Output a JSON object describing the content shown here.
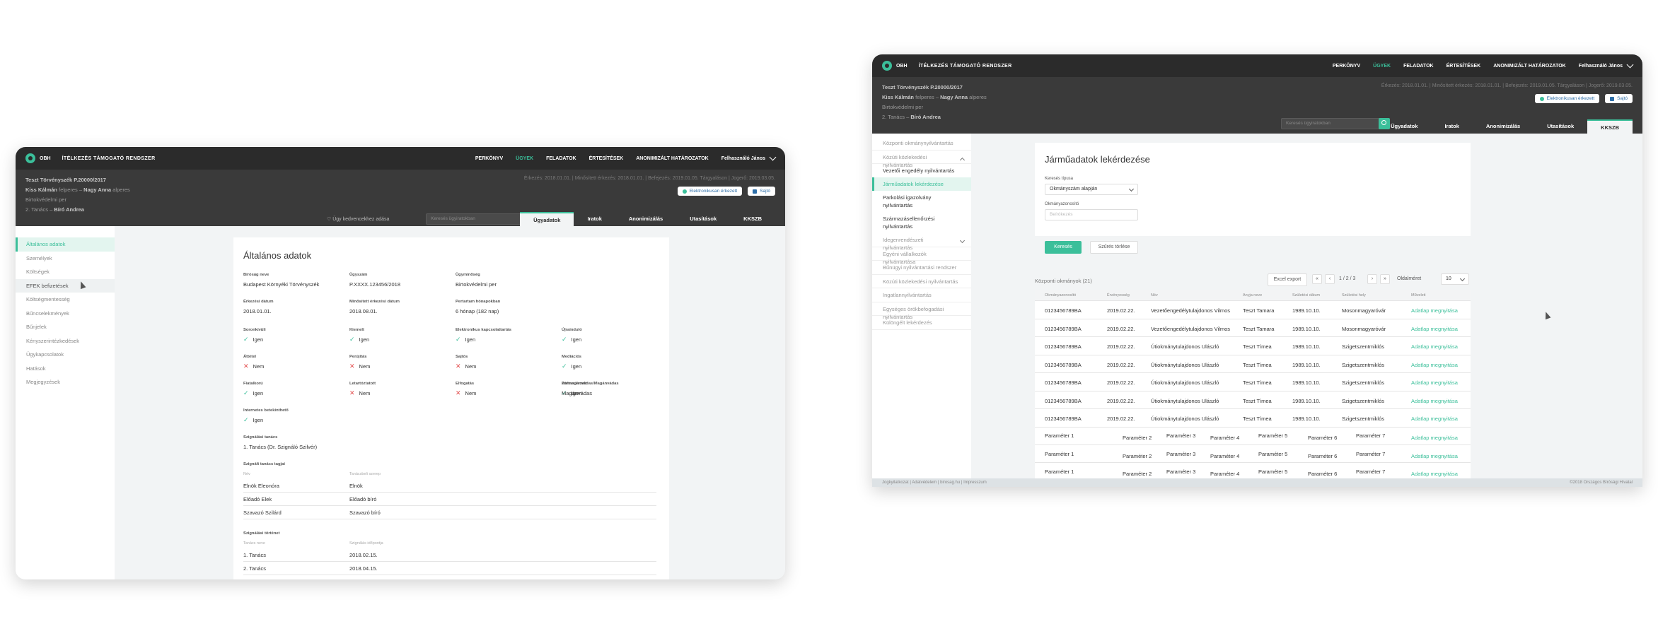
{
  "app": {
    "brand": "OBH",
    "name": "ÍTÉLKEZÉS TÁMOGATÓ RENDSZER",
    "nav": [
      "PERKÖNYV",
      "ÜGYEK",
      "FELADATOK",
      "ÉRTESÍTÉSEK",
      "ANONIMIZÁLT HATÁROZATOK"
    ],
    "user": "Felhasználó János"
  },
  "case": {
    "title": "Teszt Törvényszék P.20000/2017",
    "plaintiff": "Kiss Kálmán",
    "plaintiff_role": "felperes",
    "defendant": "Nagy Anna",
    "defendant_role": "alperes",
    "sep": "–",
    "type": "Birtokvédelmi per",
    "council": "2. Tanács",
    "judge": "Bíró Andrea",
    "dates": "Érkezés: 2018.01.01.  |  Minősített érkezés: 2018.01.01.  |  Befejezés: 2019.01.05. Tárgyaláson  |  Jogerő: 2019.03.05.",
    "btn_elektronikus": "Elektronikusan érkezett",
    "btn_sajto": "Sajtó",
    "favorite": "Ügy kedvencekhez adása",
    "search_ph": "Keresés ügyiratokban",
    "tabs": [
      "Ügyadatok",
      "Iratok",
      "Anonimizálás",
      "Utasítások",
      "KKSZB"
    ]
  },
  "w1": {
    "side": [
      "Általános adatok",
      "Személyek",
      "Költségek",
      "EFEK befizetések",
      "Költségmentesség",
      "Bűncselekmények",
      "Bűnjelek",
      "Kényszerintézkedések",
      "Ügykapcsolatok",
      "Hatások",
      "Megjegyzések"
    ],
    "title": "Általános adatok",
    "f": {
      "court_l": "Bíróság neve",
      "court_v": "Budapest Környéki Törvényszék",
      "case_l": "Ügyszám",
      "case_v": "P.XXXX.123456/2018",
      "type_l": "Ügyminőség",
      "type_v": "Birtokvédelmi per",
      "arr_l": "Érkezési dátum",
      "arr_v": "2018.01.01.",
      "qarr_l": "Minősített érkezési dátum",
      "qarr_v": "2018.08.01.",
      "dur_l": "Pertartam hónapokban",
      "dur_v": "6 hónap (182 nap)"
    },
    "flags": [
      {
        "l": "Soronkívüli",
        "v": "Igen",
        "y": true
      },
      {
        "l": "Kiemelt",
        "v": "Igen",
        "y": true
      },
      {
        "l": "Elektronikus kapcsolattartás",
        "v": "Igen",
        "y": true
      },
      {
        "l": "Újrainduló",
        "v": "Igen",
        "y": true
      },
      {
        "l": "Áttétel",
        "v": "Nem",
        "y": false
      },
      {
        "l": "Perújítás",
        "v": "Nem",
        "y": false
      },
      {
        "l": "Sajtós",
        "v": "Nem",
        "y": false
      },
      {
        "l": "Mediációs",
        "v": "Igen",
        "y": true
      },
      {
        "l": "Fiatalkorú",
        "v": "Igen",
        "y": true
      },
      {
        "l": "Letartóztatott",
        "v": "Nem",
        "y": false
      },
      {
        "l": "Elfogatás",
        "v": "Nem",
        "y": false
      },
      {
        "l": "Zártan kezelt",
        "v": "Igen",
        "y": true
      },
      {
        "l": "Internetes betekinthető",
        "v": "Igen",
        "y": true
      }
    ],
    "privacy_l": "Polmagánvádas/Magánvádas",
    "privacy_v": "Magánvádas",
    "council_l": "Szignálási tanács",
    "council_v": "1. Tanács (Dr. Szignáló Szilvér)",
    "members_l": "Szignált tanács tagjai",
    "members_h": [
      "Név",
      "Tanácsbeli szerep"
    ],
    "members": [
      [
        "Elnök Eleonóra",
        "Elnök"
      ],
      [
        "Előadó Elek",
        "Előadó bíró"
      ],
      [
        "Szavazó Szilárd",
        "Szavazó bíró"
      ]
    ],
    "hist_l": "Szignálási történet",
    "hist_h": [
      "Tanács neve",
      "Szignálás időpontja"
    ],
    "hist": [
      [
        "1. Tanács",
        "2018.02.15."
      ],
      [
        "2. Tanács",
        "2018.04.15."
      ]
    ]
  },
  "w2": {
    "side": [
      {
        "t": "Központi okmánynyilvántartás"
      },
      {
        "t": "Közúti közlekedési nyilvántartás",
        "caret": "up"
      },
      {
        "t": "Vezetői engedély nyilvántartás",
        "sub": true
      },
      {
        "t": "Járműadatok lekérdezése",
        "sub": true,
        "act": true
      },
      {
        "t": "Parkolási igazolvány nyilvántartás",
        "sub": true
      },
      {
        "t": "Származásellenőrzési nyilvántartás",
        "sub": true
      },
      {
        "t": "Idegenrendészeti nyilvántartás",
        "caret": "down"
      },
      {
        "t": "Egyéni vállalkozók nyilvántartása"
      },
      {
        "t": "Bűnügyi nyilvántartási rendszer"
      },
      {
        "t": "Közúti közlekedési nyilvántartás"
      },
      {
        "t": "Ingatlannyilvántartás"
      },
      {
        "t": "Egységes örökbefogadási nyilvántartás"
      },
      {
        "t": "Különgélt lekérdezés"
      }
    ],
    "title": "Járműadatok lekérdezése",
    "search_type_l": "Keresés típusa",
    "search_type_v": "Okmányszám alapján",
    "docnum_l": "Okmányazonosító",
    "docnum_ph": "Beírókezés",
    "search_btn": "Keresés",
    "clear_btn": "Szűrés törlése",
    "results": "Központi okmányok (21)",
    "export": "Excel export",
    "page": "1 / 2 / 3",
    "perpage_l": "Oldalméret",
    "perpage_v": "10",
    "cols": [
      "Okmányazonosító",
      "Érvényesség",
      "Név",
      "Anyja neve",
      "Születési dátum",
      "Születési hely",
      "Műveleti"
    ],
    "rows": [
      [
        "0123456789BA",
        "2019.02.22.",
        "Vezetőengedélytulajdonos Vilmos",
        "Teszt Tamara",
        "1989.10.10.",
        "Mosonmagyaróvár",
        "Adatlap megnyitása"
      ],
      [
        "0123456789BA",
        "2019.02.22.",
        "Vezetőengedélytulajdonos Vilmos",
        "Teszt Tamara",
        "1989.10.10.",
        "Mosonmagyaróvár",
        "Adatlap megnyitása"
      ],
      [
        "0123456789BA",
        "2019.02.22.",
        "Útiokmánytulajdonos Ulászló",
        "Teszt Tímea",
        "1989.10.10.",
        "Szigetszentmiklós",
        "Adatlap megnyitása"
      ],
      [
        "0123456789BA",
        "2019.02.22.",
        "Útiokmánytulajdonos Ulászló",
        "Teszt Tímea",
        "1989.10.10.",
        "Szigetszentmiklós",
        "Adatlap megnyitása"
      ],
      [
        "0123456789BA",
        "2019.02.22.",
        "Útiokmánytulajdonos Ulászló",
        "Teszt Tímea",
        "1989.10.10.",
        "Szigetszentmiklós",
        "Adatlap megnyitása"
      ],
      [
        "0123456789BA",
        "2019.02.22.",
        "Útiokmánytulajdonos Ulászló",
        "Teszt Tímea",
        "1989.10.10.",
        "Szigetszentmiklós",
        "Adatlap megnyitása"
      ],
      [
        "0123456789BA",
        "2019.02.22.",
        "Útiokmánytulajdonos Ulászló",
        "Teszt Tímea",
        "1989.10.10.",
        "Szigetszentmiklós",
        "Adatlap megnyitása"
      ]
    ],
    "prows": [
      [
        "Paraméter 1",
        "Paraméter 2",
        "Paraméter 3",
        "Paraméter 4",
        "Paraméter 5",
        "Paraméter 6",
        "Paraméter 7",
        "Adatlap megnyitása"
      ],
      [
        "Paraméter 1",
        "Paraméter 2",
        "Paraméter 3",
        "Paraméter 4",
        "Paraméter 5",
        "Paraméter 6",
        "Paraméter 7",
        "Adatlap megnyitása"
      ],
      [
        "Paraméter 1",
        "Paraméter 2",
        "Paraméter 3",
        "Paraméter 4",
        "Paraméter 5",
        "Paraméter 6",
        "Paraméter 7",
        "Adatlap megnyitása"
      ]
    ],
    "footer_l": "Jogkyilatkozat  |  Adatvédelem  |  birosag.hu  |  Impresszum",
    "footer_r": "©2018 Országos Bírósági Hivatal"
  }
}
